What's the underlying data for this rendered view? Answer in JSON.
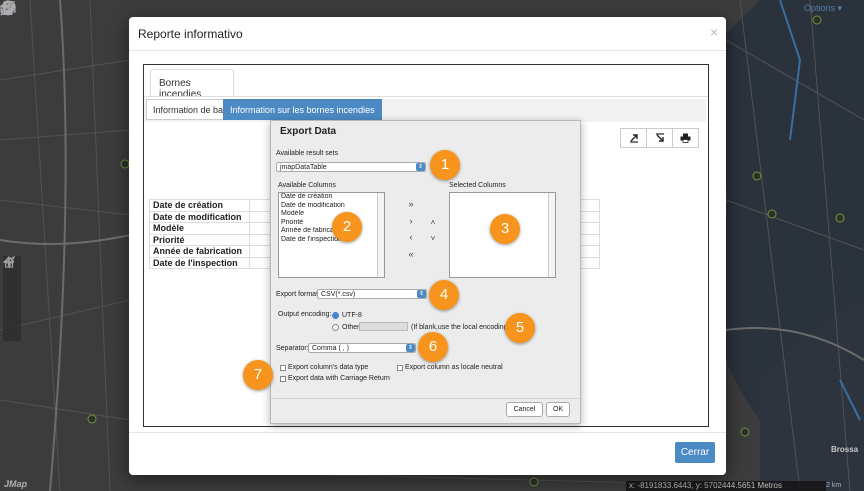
{
  "app": {
    "logo": "JMap",
    "options_label": "Options ▾",
    "coords": "x: -8191833.6443, y: 5702444.5651 Metros",
    "scale": "2 km",
    "map_place": "Brossa"
  },
  "toolbar": {
    "icons": [
      "layers-icon",
      "zoom-icon",
      "measure-icon",
      "ruler-icon",
      "route-icon",
      "person-icon",
      "pin-icon",
      "edit-icon",
      "print-icon"
    ]
  },
  "side_tools": [
    "home-icon",
    "locate-icon",
    "zoom-in-icon",
    "zoom-out-icon"
  ],
  "modal": {
    "title": "Reporte informativo",
    "close_glyph": "×",
    "tab": "Bornes incendies",
    "subtabs": [
      "Information de base",
      "Information sur les bornes incendies"
    ],
    "fields": [
      "Date de création",
      "Date de modification",
      "Modèle",
      "Priorité",
      "Année de fabrication",
      "Date de l'inspection"
    ],
    "close_button": "Cerrar"
  },
  "export": {
    "title": "Export Data",
    "result_sets_label": "Available result sets",
    "result_set_value": "jmapDataTable",
    "available_columns_label": "Available Columns",
    "available_columns": [
      "Date de création",
      "Date de modification",
      "Modèle",
      "Priorité",
      "Année de fabrication",
      "Date de l'inspection"
    ],
    "selected_columns_label": "Selected Columns",
    "selected_columns": [],
    "format_label": "Export format:",
    "format_value": "CSV(*.csv)",
    "encoding_label": "Output encoding:",
    "encoding_utf8": "UTF-8",
    "encoding_other": "Other",
    "encoding_hint": "(If blank,use the local encoding)",
    "separator_label": "Separator:",
    "separator_value": "Comma ( , )",
    "chk_data_type": "Export column's data type",
    "chk_locale": "Export column as locale neutral",
    "chk_carriage": "Export data with Carriage Return",
    "cancel": "Cancel",
    "ok": "OK"
  },
  "callouts": [
    "1",
    "2",
    "3",
    "4",
    "5",
    "6",
    "7"
  ],
  "colors": {
    "accent": "#4c8ac4",
    "callout": "#f7941d",
    "map_dark": "#4f4f4f"
  }
}
